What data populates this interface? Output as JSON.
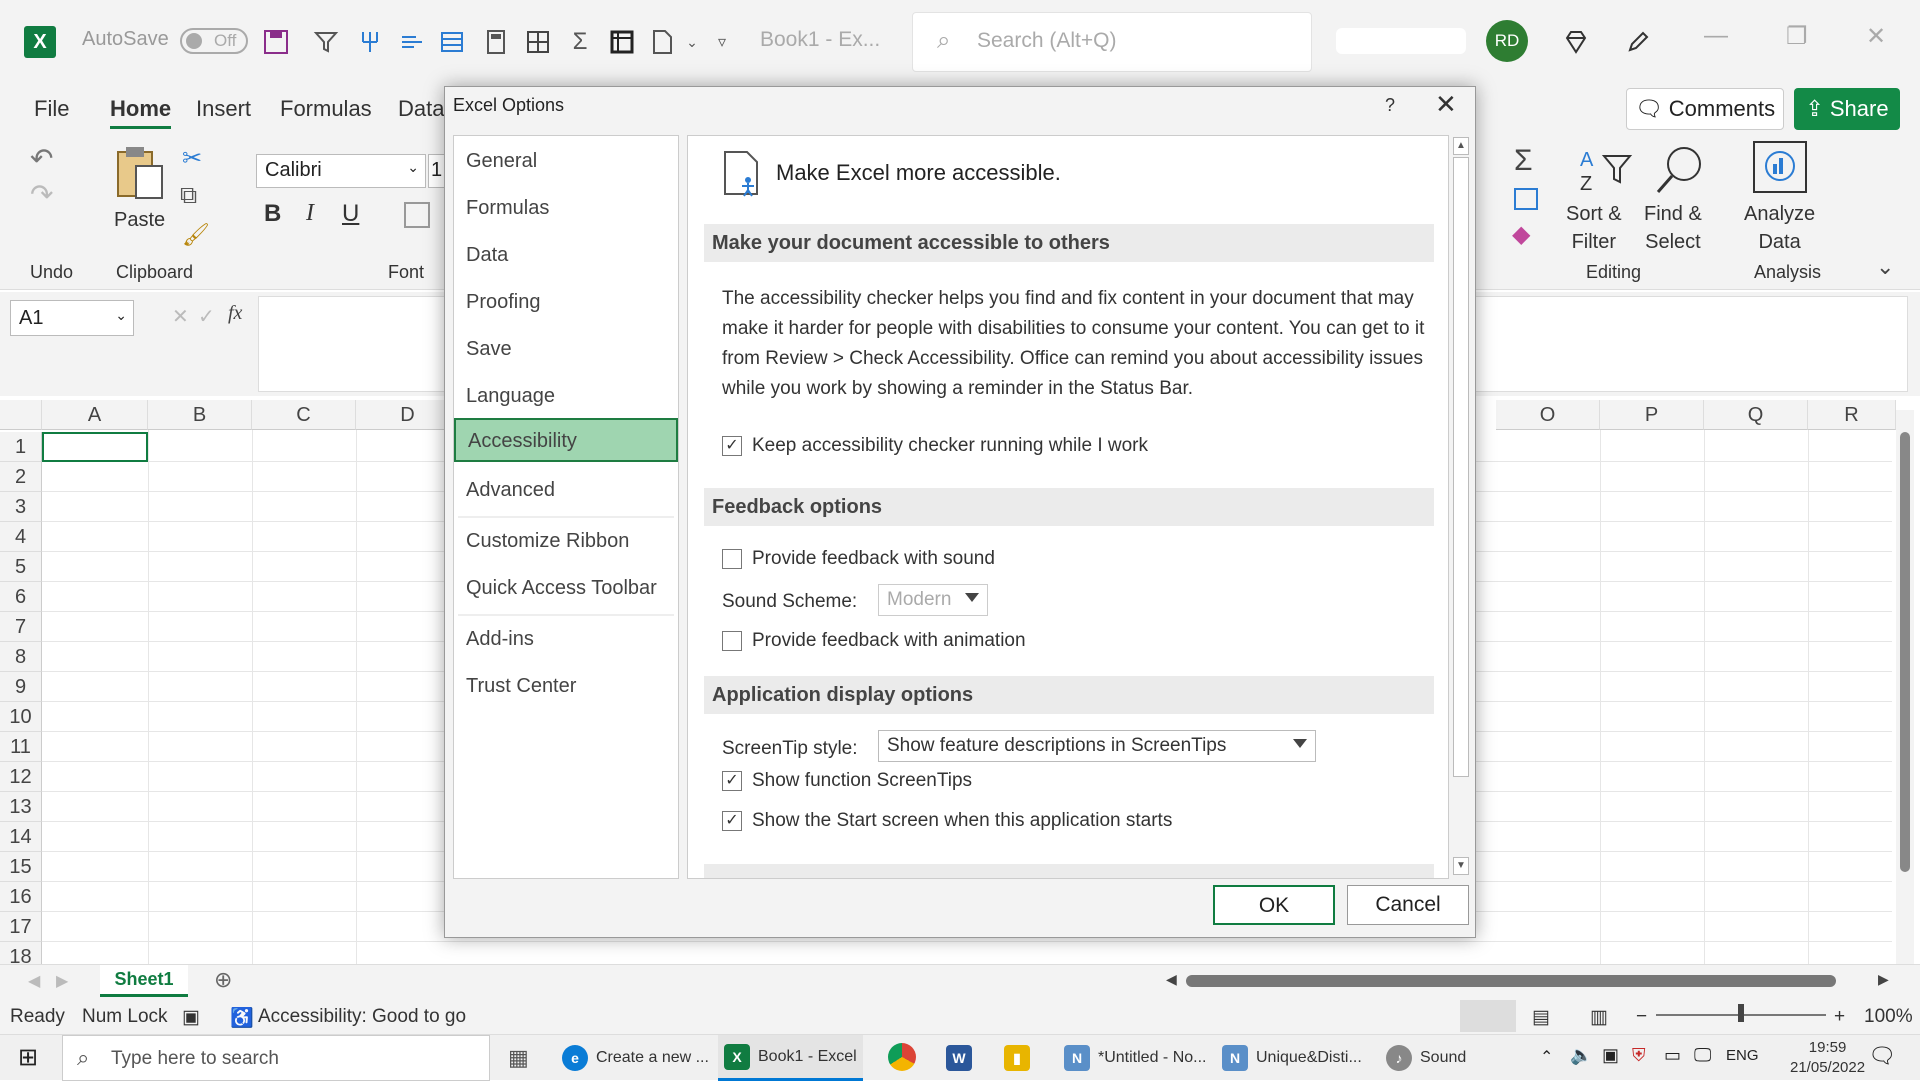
{
  "titlebar": {
    "autosave_label": "AutoSave",
    "autosave_state": "Off",
    "book_name": "Book1  -  Ex...",
    "search_placeholder": "Search (Alt+Q)",
    "avatar_initials": "RD"
  },
  "ribbon": {
    "tabs": [
      "File",
      "Home",
      "Insert",
      "Formulas",
      "Data"
    ],
    "active_tab": "Home",
    "comments_label": "Comments",
    "share_label": "Share",
    "undo_label": "Undo",
    "paste_label": "Paste",
    "clipboard_label": "Clipboard",
    "font_name": "Calibri",
    "font_size": "1",
    "font_group_label": "Font",
    "bold": "B",
    "italic": "I",
    "underline": "U",
    "sort_filter_label": "Sort &\nFilter",
    "find_select_label": "Find &\nSelect",
    "editing_label": "Editing",
    "analyze_label": "Analyze\nData",
    "analysis_label": "Analysis"
  },
  "formula_bar": {
    "name_box": "A1",
    "fx": "fx"
  },
  "grid": {
    "columns_left": [
      "A",
      "B",
      "C",
      "D"
    ],
    "columns_right": [
      "O",
      "P",
      "Q",
      "R"
    ],
    "rows": [
      "1",
      "2",
      "3",
      "4",
      "5",
      "6",
      "7",
      "8",
      "9",
      "10",
      "11",
      "12",
      "13",
      "14",
      "15",
      "16",
      "17",
      "18"
    ]
  },
  "sheets": {
    "active": "Sheet1"
  },
  "status": {
    "ready": "Ready",
    "num_lock": "Num Lock",
    "accessibility": "Accessibility: Good to go",
    "zoom": "100%"
  },
  "taskbar": {
    "search_placeholder": "Type here to search",
    "items": [
      {
        "label": "Create a new ...",
        "color": "#0a7cd6"
      },
      {
        "label": "Book1 - Excel",
        "color": "#107c41"
      },
      {
        "label": "*Untitled - No...",
        "color": "#5a8fc8"
      },
      {
        "label": "Unique&Disti...",
        "color": "#5a8fc8"
      },
      {
        "label": "Sound",
        "color": "#888888"
      }
    ],
    "language": "ENG",
    "time": "19:59",
    "date": "21/05/2022"
  },
  "dialog": {
    "title": "Excel Options",
    "help": "?",
    "categories": [
      "General",
      "Formulas",
      "Data",
      "Proofing",
      "Save",
      "Language",
      "Accessibility",
      "Advanced",
      "Customize Ribbon",
      "Quick Access Toolbar",
      "Add-ins",
      "Trust Center"
    ],
    "selected_category": "Accessibility",
    "heading": "Make Excel more accessible.",
    "sections": {
      "doc": "Make your document accessible to others",
      "feedback": "Feedback options",
      "display": "Application display options"
    },
    "doc_paragraph": "The accessibility checker helps you find and fix content in your document that may make it harder for people with disabilities to consume your content. You can get to it from Review > Check Accessibility. Office can remind you about accessibility issues while you work by showing a reminder in the Status Bar.",
    "options": {
      "keep_checker": {
        "label": "Keep accessibility checker running while I work",
        "checked": true
      },
      "feedback_sound": {
        "label": "Provide feedback with sound",
        "checked": false
      },
      "feedback_animation": {
        "label": "Provide feedback with animation",
        "checked": false
      },
      "function_screentips": {
        "label": "Show function ScreenTips",
        "checked": true
      },
      "start_screen": {
        "label": "Show the Start screen when this application starts",
        "checked": true
      }
    },
    "sound_scheme_label": "Sound Scheme:",
    "sound_scheme_value": "Modern",
    "screentip_label": "ScreenTip style:",
    "screentip_value": "Show feature descriptions in ScreenTips",
    "ok_label": "OK",
    "cancel_label": "Cancel"
  },
  "colors": {
    "excel_green": "#107c41",
    "selected_category_bg": "#9fd5b0"
  }
}
